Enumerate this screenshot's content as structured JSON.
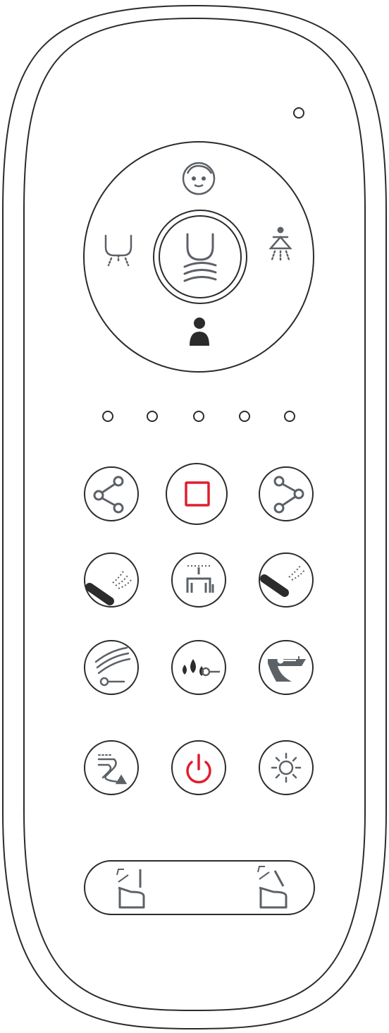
{
  "device": {
    "kind": "toilet-bidet-remote",
    "colors": {
      "outline": "#2b2b2b",
      "icon_gray": "#5c6166",
      "accent_red": "#e01e2e",
      "body": "#ffffff"
    }
  },
  "dial": {
    "top_icon": "child-face-icon",
    "left_icon": "rear-wash-icon",
    "right_icon": "feminine-wash-icon",
    "bottom_icon": "user-icon",
    "center_icon": "wash-dry-icon"
  },
  "indicators": {
    "top_led": 1,
    "level_leds": 5
  },
  "buttons": [
    {
      "row": 1,
      "items": [
        "share-left-icon",
        "stop-icon",
        "share-right-icon"
      ]
    },
    {
      "row": 2,
      "items": [
        "nozzle-spray-left-icon",
        "nozzle-clean-icon",
        "nozzle-spray-right-icon"
      ]
    },
    {
      "row": 3,
      "items": [
        "dryer-temp-icon",
        "water-temp-icon",
        "seat-temp-icon"
      ]
    },
    {
      "row": 4,
      "items": [
        "deodorizer-icon",
        "power-icon",
        "night-light-icon"
      ]
    }
  ],
  "lid_bar": {
    "left": "seat-lid-open-icon",
    "right": "lid-open-icon"
  }
}
